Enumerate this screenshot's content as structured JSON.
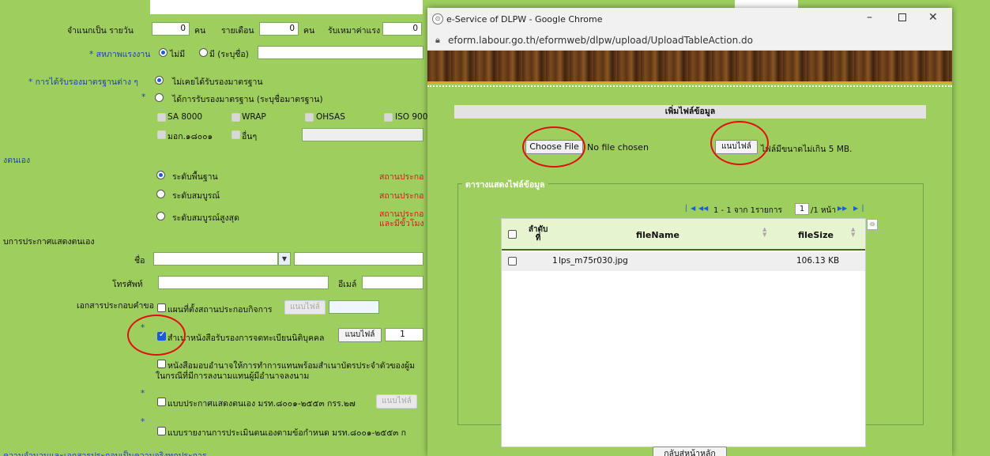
{
  "form": {
    "daily_label": "จำแนกเป็น รายวัน",
    "daily_value": "0",
    "person_unit_1": "คน",
    "monthly_label": "รายเดือน",
    "monthly_value": "0",
    "person_unit_2": "คน",
    "contract_label": "รับเหมาค่าแรง",
    "contract_value": "0",
    "union_label": "* สหภาพแรงงาน",
    "union_no": "ไม่มี",
    "union_yes": "มี (ระบุชื่อ)",
    "cert_label": "* การได้รับรองมาตรฐานต่าง ๆ",
    "cert_never": "ไม่เคยได้รับรองมาตรฐาน",
    "cert_star": "*",
    "cert_has": "ได้การรับรองมาตรฐาน (ระบุชื่อมาตรฐาน)",
    "std_sa": "SA 8000",
    "std_wrap": "WRAP",
    "std_ohsas": "OHSAS",
    "std_iso": "ISO 900",
    "std_mok": "มอก.๑๘๐๐๑",
    "std_other": "อื่นๆ",
    "section_self": "งตนเอง",
    "level_basic": "ระดับพื้นฐาน",
    "level_full": "ระดับสมบูรณ์",
    "level_top": "ระดับสมบูรณ์สูงสุด",
    "red1": "สถานประกอ",
    "red2": "สถานประกอ",
    "red3a": "สถานประกอ",
    "red3b": "และมีขั้วโมง",
    "section_announce": "บการประกาศแสดงตนเอง",
    "name_label": "ชื่อ",
    "phone_label": "โทรศัพท์",
    "email_label": "อีเมล์",
    "docs_label": "เอกสารประกอบคำขอ",
    "doc_map": "แผนที่ตั้งสถานประกอบกิจการ",
    "attach_label": "แนบไฟล์",
    "doc_star1": "*",
    "doc_registration": "สำเนาหนังสือรับรองการจดทะเบียนนิติบุคคล",
    "doc_registration_count": "1",
    "doc_proxy_1": "หนังสือมอบอำนาจให้การทำการแทนพร้อมสำเนาบัตรประจำตัวของผู้ม",
    "doc_proxy_2": "ในกรณีที่มีการลงนามแทนผู้มีอำนาจลงนาม",
    "doc_star2": "*",
    "doc_announce": "แบบประกาศแสดงตนเอง มรท.๘๐๐๑-๒๕๕๓ กรร.๒๗",
    "doc_star3": "*",
    "doc_report": "แบบรายงานการประเมินตนเองตามข้อกำหนด มรท.๘๐๐๑-๒๕๕๓ ก",
    "footer_text": "ความจำนวนและเอกสารประกอบเป็นความจริงทุกประการ"
  },
  "popup": {
    "window_title": "e-Service of DLPW - Google Chrome",
    "url": "eform.labour.go.th/eformweb/dlpw/upload/UploadTableAction.do",
    "add_file_header": "เพิ่มไฟล์ข้อมูล",
    "choose_file": "Choose File",
    "no_file": "No file chosen",
    "attach_button": "แนบไฟล์",
    "size_note": "ไฟล์มีขนาดไม่เกิน 5 MB.",
    "table_legend": "ตารางแสดงไฟล์ข้อมูล",
    "pager_text_a": "1 - 1 จาก 1รายการ",
    "page_value": "1",
    "pager_text_b": "/1 หน้า",
    "col_seq": "ลำดับ ที่",
    "col_filename": "fileName",
    "col_filesize": "fileSize",
    "rows": [
      {
        "seq": "1",
        "fileName": "lps_m75r030.jpg",
        "fileSize": "106.13 KB"
      }
    ],
    "back_button": "กลับสู่หน้าหลัก",
    "colors": {
      "accent_red": "#e01010",
      "banner": "#6c3f1a",
      "green": "#9ecf5e"
    },
    "icons": [
      "lock-icon",
      "chrome-icon",
      "minimize-icon",
      "maximize-icon",
      "close-icon",
      "first-page-icon",
      "prev-page-icon",
      "next-page-icon",
      "last-page-icon",
      "delete-icon"
    ]
  }
}
